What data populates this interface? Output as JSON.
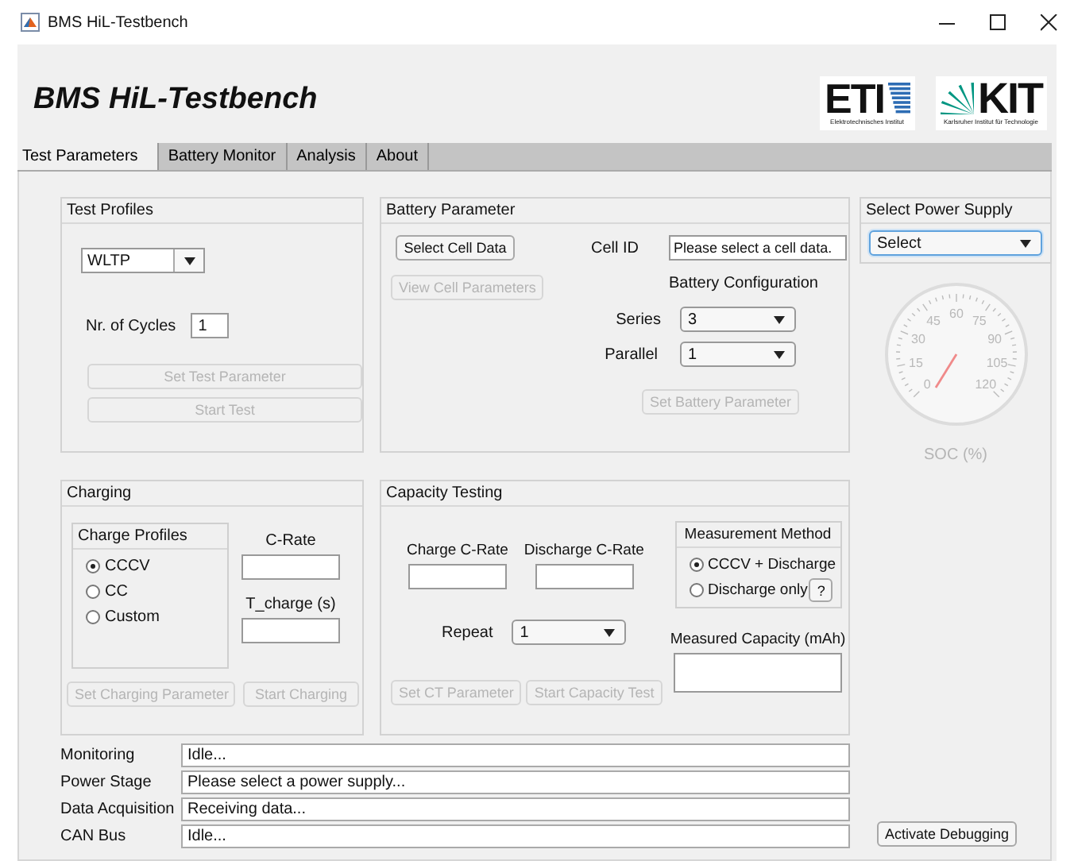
{
  "window": {
    "title": "BMS HiL-Testbench"
  },
  "header": {
    "title": "BMS HiL-Testbench",
    "logos": [
      {
        "kind": "eti",
        "mark": "ETI",
        "caption": "Elektrotechnisches Institut"
      },
      {
        "kind": "kit",
        "mark": "KIT",
        "caption": "Karlsruher Institut für Technologie"
      }
    ]
  },
  "tabs": [
    {
      "label": "Test Parameters",
      "selected": true
    },
    {
      "label": "Battery Monitor",
      "selected": false
    },
    {
      "label": "Analysis",
      "selected": false
    },
    {
      "label": "About",
      "selected": false
    }
  ],
  "test_profiles": {
    "title": "Test Profiles",
    "profile": "WLTP",
    "cycles_label": "Nr. of Cycles",
    "cycles_value": "1",
    "buttons": [
      {
        "label": "Set Test Parameter",
        "disabled": true
      },
      {
        "label": "Start Test",
        "disabled": true
      }
    ]
  },
  "battery_parameter": {
    "title": "Battery Parameter",
    "select_button": {
      "label": "Select Cell Data",
      "disabled": false
    },
    "view_button": {
      "label": "View Cell Parameters",
      "disabled": true
    },
    "cell_id_label": "Cell ID",
    "cell_id_value": "Please select a cell data.",
    "config_title": "Battery Configuration",
    "series": {
      "label": "Series",
      "value": "3"
    },
    "parallel": {
      "label": "Parallel",
      "value": "1"
    },
    "set_button": {
      "label": "Set Battery Parameter",
      "disabled": true
    }
  },
  "power_supply": {
    "title": "Select Power Supply",
    "value": "Select"
  },
  "gauge": {
    "ticks": [
      "0",
      "15",
      "30",
      "45",
      "60",
      "75",
      "90",
      "105",
      "120"
    ],
    "label": "SOC (%)"
  },
  "charging": {
    "title": "Charging",
    "profiles_title": "Charge Profiles",
    "profiles": [
      {
        "label": "CCCV",
        "selected": true
      },
      {
        "label": "CC",
        "selected": false
      },
      {
        "label": "Custom",
        "selected": false
      }
    ],
    "c_rate_label": "C-Rate",
    "t_charge_label": "T_charge (s)",
    "buttons": [
      {
        "label": "Set Charging Parameter",
        "disabled": true
      },
      {
        "label": "Start Charging",
        "disabled": true
      }
    ]
  },
  "capacity_testing": {
    "title": "Capacity Testing",
    "charge_label": "Charge C-Rate",
    "discharge_label": "Discharge C-Rate",
    "method_title": "Measurement Method",
    "methods": [
      {
        "label": "CCCV + Discharge",
        "selected": true
      },
      {
        "label": "Discharge only",
        "selected": false
      }
    ],
    "help": "?",
    "repeat_label": "Repeat",
    "repeat_value": "1",
    "measured_label": "Measured Capacity (mAh)",
    "buttons": [
      {
        "label": "Set CT Parameter",
        "disabled": true
      },
      {
        "label": "Start Capacity Test",
        "disabled": true
      }
    ]
  },
  "status": [
    {
      "label": "Monitoring",
      "value": "Idle..."
    },
    {
      "label": "Power Stage",
      "value": "Please select a power supply..."
    },
    {
      "label": "Data Acquisition",
      "value": "Receiving data..."
    },
    {
      "label": "CAN Bus",
      "value": "Idle..."
    }
  ],
  "debug_button": {
    "label": "Activate Debugging",
    "disabled": false
  }
}
